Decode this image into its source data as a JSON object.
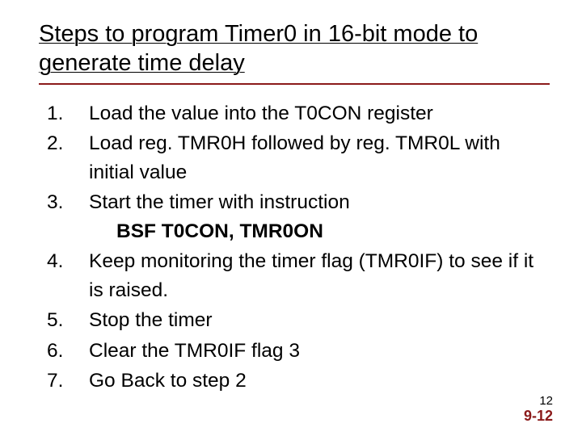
{
  "title": "Steps to program Timer0 in 16-bit mode to generate time delay",
  "steps": {
    "s1": "Load the value into the T0CON register",
    "s2": "Load reg. TMR0H followed by reg. TMR0L with initial value",
    "s3": "Start the timer with instruction",
    "s3_code": "BSF T0CON, TMR0ON",
    "s4": "Keep monitoring the timer flag (TMR0IF) to see if it is raised.",
    "s5": "Stop the timer",
    "s6": "Clear the TMR0IF flag 3",
    "s7": "Go Back to step 2"
  },
  "page_small": "12",
  "page_big": "9-12"
}
